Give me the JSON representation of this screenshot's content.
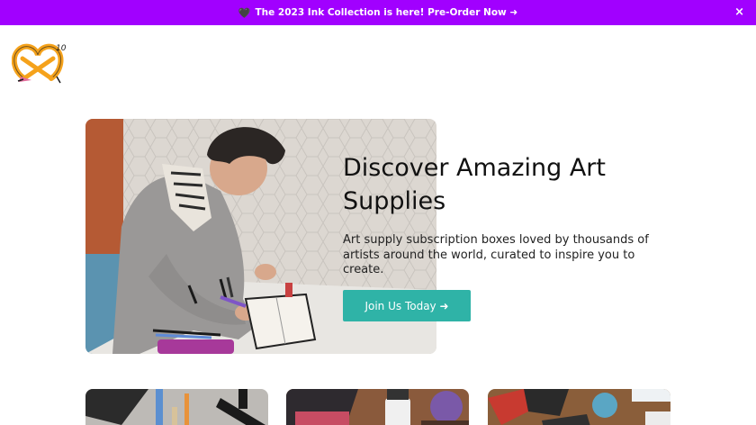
{
  "announcement": {
    "heart": "🖤",
    "text": "The 2023 Ink Collection is here! Pre-Order Now ➜",
    "close": "×"
  },
  "logo": {
    "badge": "10"
  },
  "hero": {
    "title": "Discover Amazing Art Supplies",
    "subtitle": "Art supply subscription boxes loved by thousands of artists around the world, curated to inspire you to create.",
    "cta_label": "Join Us Today ➜"
  },
  "colors": {
    "announcement_bg": "#a100ff",
    "cta_bg": "#2fb3a7",
    "logo_orange": "#f5a21b"
  }
}
